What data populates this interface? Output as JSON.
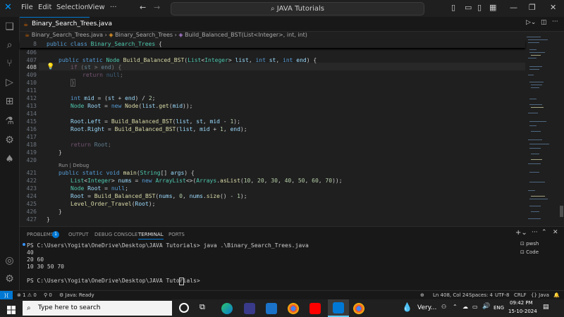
{
  "menu": {
    "items": [
      "File",
      "Edit",
      "Selection",
      "View",
      "···"
    ]
  },
  "command_center": {
    "label": "JAVA Tutorials"
  },
  "tab": {
    "label": "Binary_Search_Trees.java"
  },
  "breadcrumb": {
    "file": "Binary_Search_Trees.java",
    "cls": "Binary_Search_Trees",
    "method": "Build_Balanced_BST(List<Integer>, int, int)"
  },
  "editor": {
    "line_numbers": [
      "8",
      "406",
      "407",
      "408",
      "409",
      "410",
      "411",
      "412",
      "413",
      "414",
      "415",
      "416",
      "417",
      "418",
      "419",
      "420",
      "421",
      "422",
      "423",
      "424",
      "425",
      "426",
      "427"
    ],
    "codelens": "Run | Debug"
  },
  "panel": {
    "tabs": [
      "PROBLEMS",
      "OUTPUT",
      "DEBUG CONSOLE",
      "TERMINAL",
      "PORTS"
    ],
    "problems_badge": "1",
    "terminal_lines": [
      "PS C:\\Users\\Yogita\\OneDrive\\Desktop\\JAVA Tutorials> java .\\Binary_Search_Trees.java",
      "40",
      "20 60",
      "10 30 50 70",
      "",
      "PS C:\\Users\\Yogita\\OneDrive\\Desktop\\JAVA Tutorials> "
    ],
    "shells": [
      "pwsh",
      "Code"
    ]
  },
  "status": {
    "errors": "1",
    "warnings": "0",
    "ports": "0",
    "java": "Java: Ready",
    "position": "Ln 408, Col 24",
    "spaces": "Spaces: 4",
    "encoding": "UTF-8",
    "eol": "CRLF",
    "lang": "{} Java"
  },
  "taskbar": {
    "search_placeholder": "Type here to search",
    "weather": "Very...",
    "lang": "ENG",
    "time": "09:42 PM",
    "date": "15-10-2024"
  },
  "colors": {
    "accent": "#0078d4",
    "background": "#1f1f1f"
  }
}
